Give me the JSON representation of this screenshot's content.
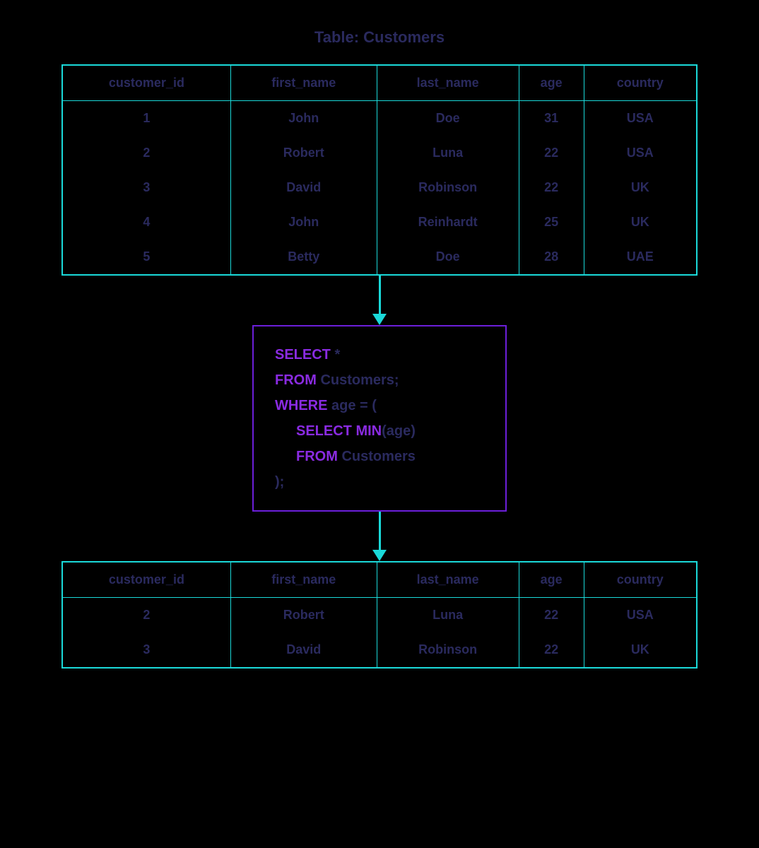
{
  "title": "Table: Customers",
  "columns": [
    "customer_id",
    "first_name",
    "last_name",
    "age",
    "country"
  ],
  "source_rows": [
    [
      "1",
      "John",
      "Doe",
      "31",
      "USA"
    ],
    [
      "2",
      "Robert",
      "Luna",
      "22",
      "USA"
    ],
    [
      "3",
      "David",
      "Robinson",
      "22",
      "UK"
    ],
    [
      "4",
      "John",
      "Reinhardt",
      "25",
      "UK"
    ],
    [
      "5",
      "Betty",
      "Doe",
      "28",
      "UAE"
    ]
  ],
  "result_rows": [
    [
      "2",
      "Robert",
      "Luna",
      "22",
      "USA"
    ],
    [
      "3",
      "David",
      "Robinson",
      "22",
      "UK"
    ]
  ],
  "sql": {
    "l1_kw": "SELECT",
    "l1_tx": " *",
    "l2_kw": "FROM",
    "l2_tx": " Customers;",
    "l3_kw": "WHERE",
    "l3_tx": " age = (",
    "l4_kw": "SELECT MIN",
    "l4_tx": "(age)",
    "l5_kw": "FROM",
    "l5_tx": " Customers",
    "l6_tx": ");"
  }
}
